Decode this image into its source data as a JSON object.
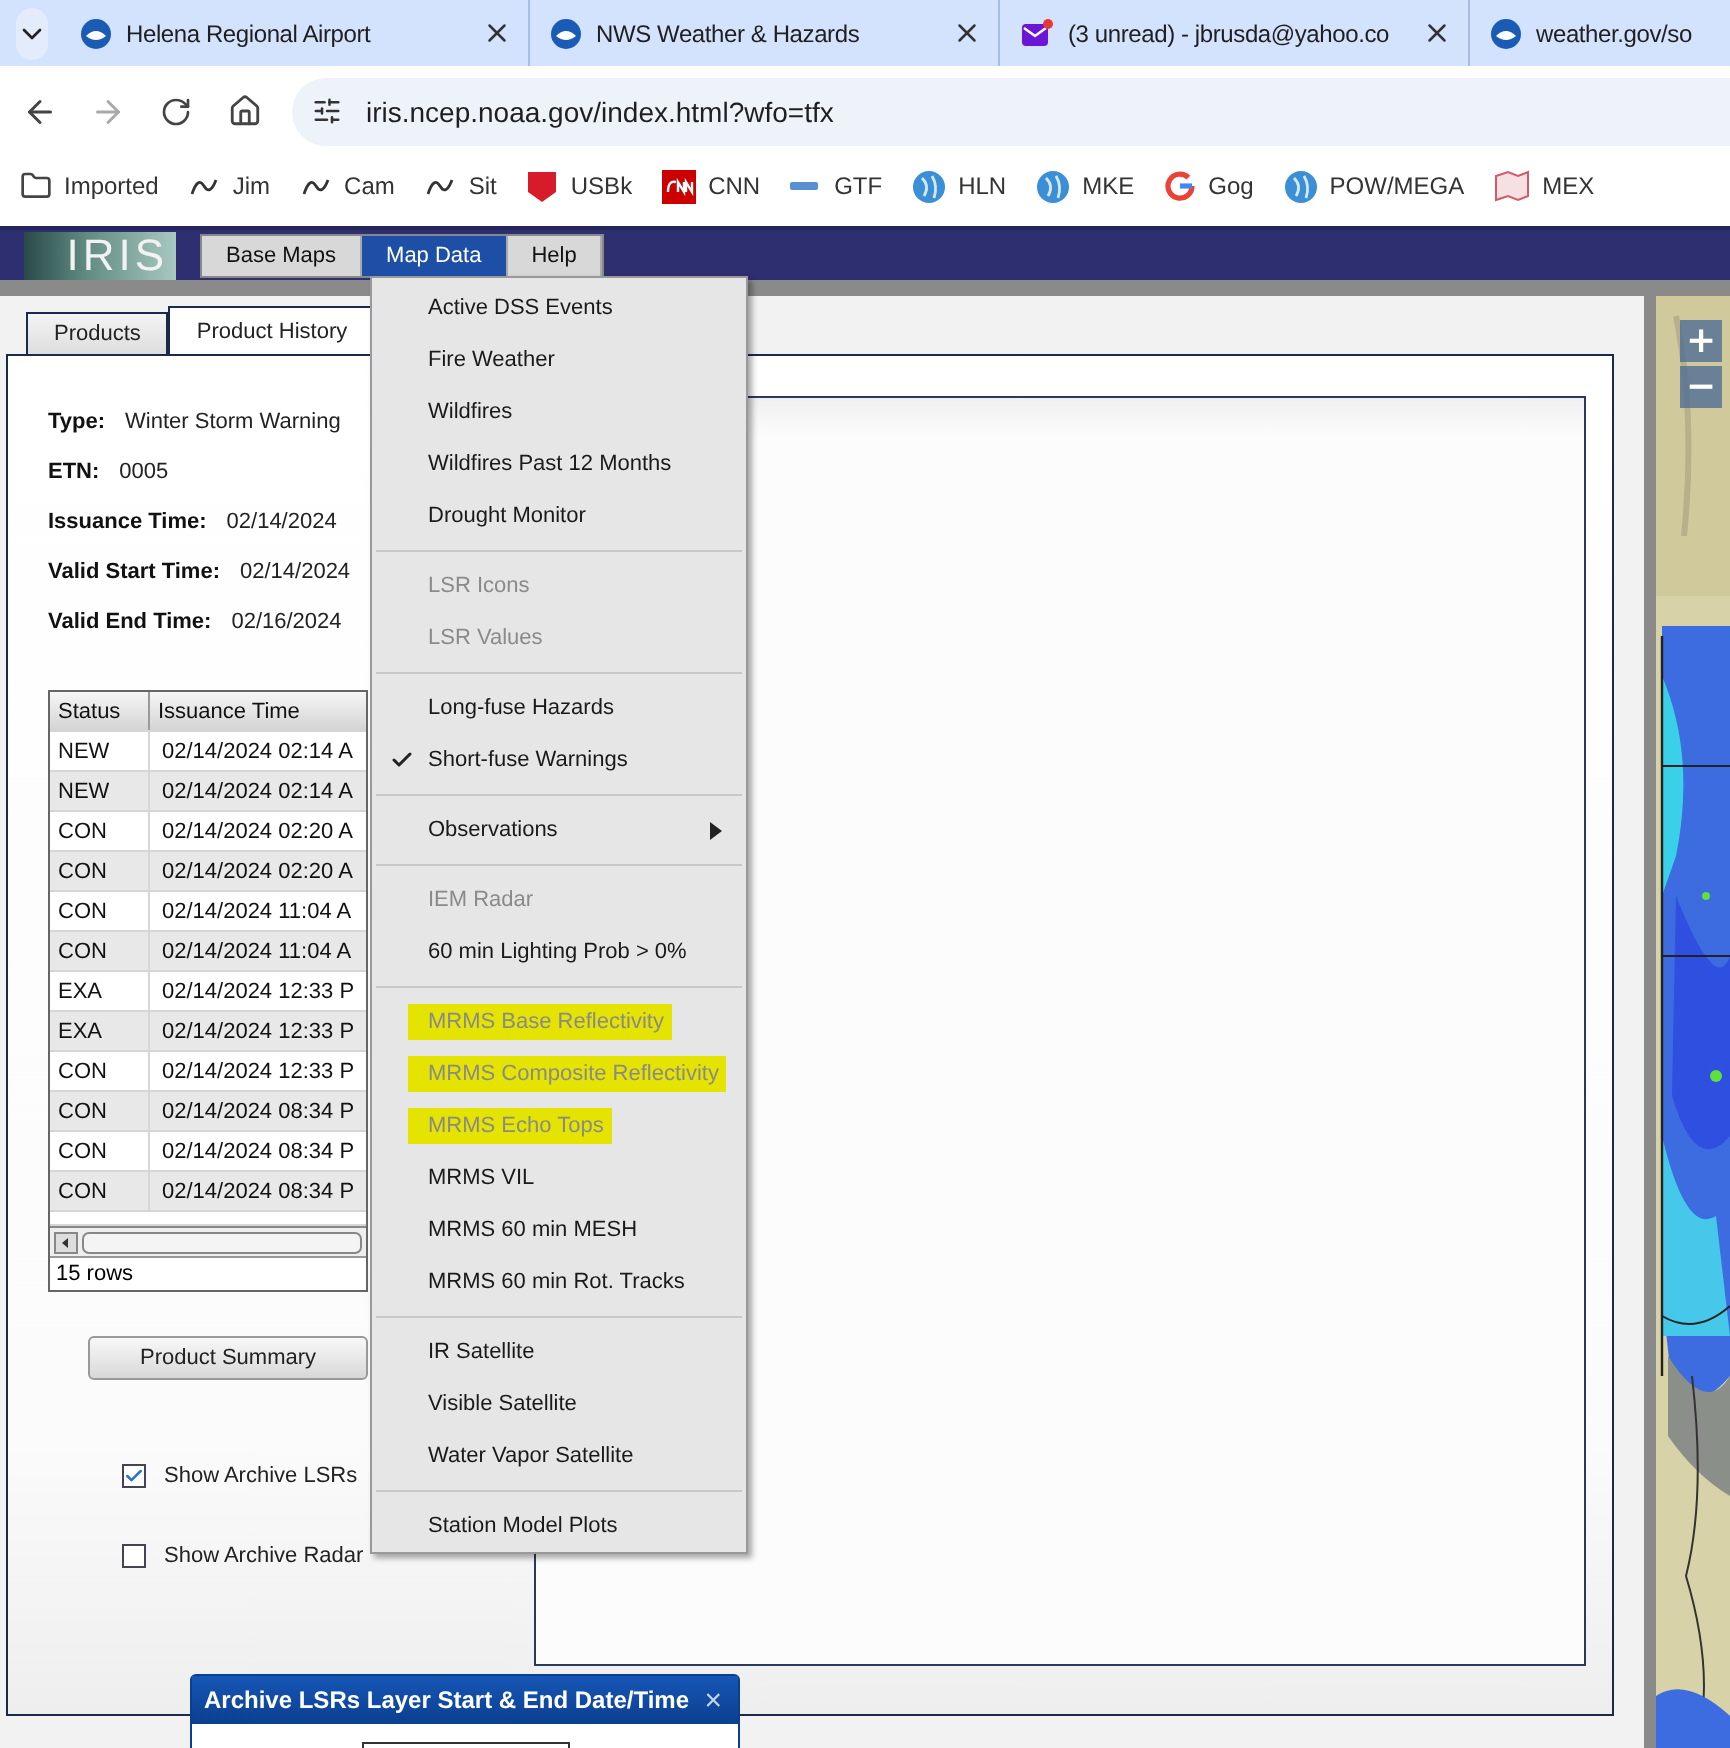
{
  "browser": {
    "tabs": [
      {
        "title": "Helena Regional Airport",
        "kind": "noaa"
      },
      {
        "title": "NWS Weather & Hazards",
        "kind": "noaa"
      },
      {
        "title": "(3 unread) - jbrusda@yahoo.co",
        "kind": "mail"
      },
      {
        "title": "weather.gov/so",
        "kind": "noaa"
      }
    ],
    "address": "iris.ncep.noaa.gov/index.html?wfo=tfx",
    "bookmarks": [
      {
        "label": "Imported",
        "kind": "folder"
      },
      {
        "label": "Jim",
        "kind": "script"
      },
      {
        "label": "Cam",
        "kind": "script"
      },
      {
        "label": "Sit",
        "kind": "script"
      },
      {
        "label": "USBk",
        "kind": "shield"
      },
      {
        "label": "CNN",
        "kind": "news"
      },
      {
        "label": "GTF",
        "kind": "small"
      },
      {
        "label": "HLN",
        "kind": "globe"
      },
      {
        "label": "MKE",
        "kind": "globe"
      },
      {
        "label": "Gog",
        "kind": "google"
      },
      {
        "label": "POW/MEGA",
        "kind": "globe"
      },
      {
        "label": "MEX",
        "kind": "map"
      }
    ]
  },
  "app": {
    "logo": "IRIS",
    "menubar": [
      {
        "label": "Base Maps",
        "selected": false
      },
      {
        "label": "Map Data",
        "selected": true
      },
      {
        "label": "Help",
        "selected": false
      }
    ],
    "menu": [
      {
        "items": [
          {
            "label": "Active DSS Events",
            "disabled": false,
            "checked": false,
            "highlighted": false,
            "submenu": false
          },
          {
            "label": "Fire Weather",
            "disabled": false,
            "checked": false,
            "highlighted": false,
            "submenu": false
          },
          {
            "label": "Wildfires",
            "disabled": false,
            "checked": false,
            "highlighted": false,
            "submenu": false
          },
          {
            "label": "Wildfires Past 12 Months",
            "disabled": false,
            "checked": false,
            "highlighted": false,
            "submenu": false
          },
          {
            "label": "Drought Monitor",
            "disabled": false,
            "checked": false,
            "highlighted": false,
            "submenu": false
          }
        ]
      },
      {
        "items": [
          {
            "label": "LSR Icons",
            "disabled": true,
            "checked": false,
            "highlighted": false,
            "submenu": false
          },
          {
            "label": "LSR Values",
            "disabled": true,
            "checked": false,
            "highlighted": false,
            "submenu": false
          }
        ]
      },
      {
        "items": [
          {
            "label": "Long-fuse Hazards",
            "disabled": false,
            "checked": false,
            "highlighted": false,
            "submenu": false
          },
          {
            "label": "Short-fuse Warnings",
            "disabled": false,
            "checked": true,
            "highlighted": false,
            "submenu": false
          }
        ]
      },
      {
        "items": [
          {
            "label": "Observations",
            "disabled": false,
            "checked": false,
            "highlighted": false,
            "submenu": true
          }
        ]
      },
      {
        "items": [
          {
            "label": "IEM Radar",
            "disabled": true,
            "checked": false,
            "highlighted": false,
            "submenu": false
          },
          {
            "label": "60 min Lighting Prob > 0%",
            "disabled": false,
            "checked": false,
            "highlighted": false,
            "submenu": false
          }
        ]
      },
      {
        "items": [
          {
            "label": "MRMS Base Reflectivity",
            "disabled": true,
            "checked": false,
            "highlighted": true,
            "submenu": false
          },
          {
            "label": "MRMS Composite Reflectivity",
            "disabled": true,
            "checked": false,
            "highlighted": true,
            "submenu": false
          },
          {
            "label": "MRMS Echo Tops",
            "disabled": true,
            "checked": false,
            "highlighted": true,
            "submenu": false
          },
          {
            "label": "MRMS VIL",
            "disabled": false,
            "checked": false,
            "highlighted": false,
            "submenu": false
          },
          {
            "label": "MRMS 60 min MESH",
            "disabled": false,
            "checked": false,
            "highlighted": false,
            "submenu": false
          },
          {
            "label": "MRMS 60 min Rot. Tracks",
            "disabled": false,
            "checked": false,
            "highlighted": false,
            "submenu": false
          }
        ]
      },
      {
        "items": [
          {
            "label": "IR Satellite",
            "disabled": false,
            "checked": false,
            "highlighted": false,
            "submenu": false
          },
          {
            "label": "Visible Satellite",
            "disabled": false,
            "checked": false,
            "highlighted": false,
            "submenu": false
          },
          {
            "label": "Water Vapor Satellite",
            "disabled": false,
            "checked": false,
            "highlighted": false,
            "submenu": false
          }
        ]
      },
      {
        "items": [
          {
            "label": "Station Model Plots",
            "disabled": false,
            "checked": false,
            "highlighted": false,
            "submenu": false
          }
        ]
      }
    ],
    "panel_tabs": [
      {
        "label": "Products",
        "selected": false
      },
      {
        "label": "Product History",
        "selected": true
      }
    ],
    "history": {
      "fields": [
        {
          "label": "Type:",
          "value": "Winter Storm Warning"
        },
        {
          "label": "ETN:",
          "value": "0005"
        },
        {
          "label": "Issuance Time:",
          "value": "02/14/2024"
        },
        {
          "label": "Valid Start Time:",
          "value": "02/14/2024"
        },
        {
          "label": "Valid End Time:",
          "value": "02/16/2024"
        }
      ],
      "table": {
        "columns": [
          "Status",
          "Issuance Time"
        ],
        "rows": [
          [
            "NEW",
            "02/14/2024 02:14 A"
          ],
          [
            "NEW",
            "02/14/2024 02:14 A"
          ],
          [
            "CON",
            "02/14/2024 02:20 A"
          ],
          [
            "CON",
            "02/14/2024 02:20 A"
          ],
          [
            "CON",
            "02/14/2024 11:04 A"
          ],
          [
            "CON",
            "02/14/2024 11:04 A"
          ],
          [
            "EXA",
            "02/14/2024 12:33 P"
          ],
          [
            "EXA",
            "02/14/2024 12:33 P"
          ],
          [
            "CON",
            "02/14/2024 12:33 P"
          ],
          [
            "CON",
            "02/14/2024 08:34 P"
          ],
          [
            "CON",
            "02/14/2024 08:34 P"
          ],
          [
            "CON",
            "02/14/2024 08:34 P"
          ]
        ],
        "footer": "15 rows"
      },
      "button": "Product Summary",
      "options": [
        {
          "label": "Show Archive LSRs",
          "checked": true
        },
        {
          "label": "Show Archive Radar",
          "checked": false
        }
      ]
    },
    "dialog": {
      "title": "Archive LSRs Layer Start & End Date/Time",
      "close": "×"
    },
    "map": {
      "zoom_in": "+",
      "zoom_out": "−"
    }
  }
}
